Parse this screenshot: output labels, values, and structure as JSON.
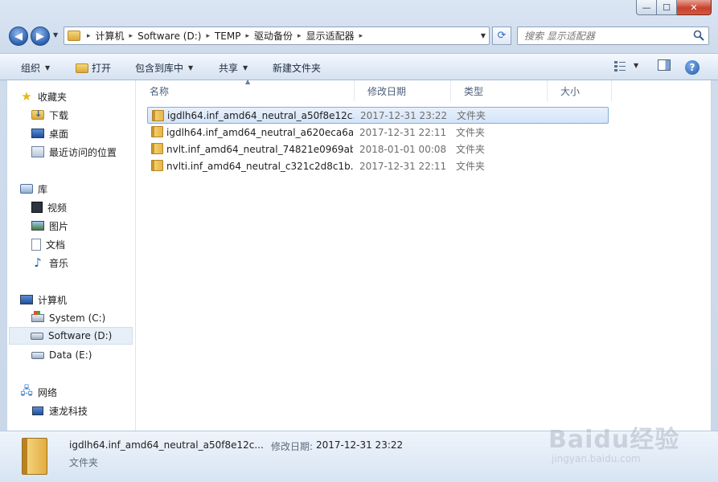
{
  "window": {
    "minimize": "—",
    "maximize": "☐",
    "close": "✕"
  },
  "address": {
    "crumbs": [
      "计算机",
      "Software (D:)",
      "TEMP",
      "驱动备份",
      "显示适配器"
    ],
    "separator": "▸"
  },
  "search": {
    "placeholder": "搜索 显示适配器"
  },
  "toolbar": {
    "organize": "组织",
    "open": "打开",
    "include_in_library": "包含到库中",
    "share": "共享",
    "new_folder": "新建文件夹"
  },
  "nav": {
    "favorites": "收藏夹",
    "downloads": "下载",
    "desktop": "桌面",
    "recent": "最近访问的位置",
    "libraries": "库",
    "videos": "视频",
    "pictures": "图片",
    "documents": "文档",
    "music": "音乐",
    "computer": "计算机",
    "drive_c": "System (C:)",
    "drive_d": "Software (D:)",
    "drive_e": "Data (E:)",
    "network": "网络",
    "network_pc": "速龙科技"
  },
  "columns": {
    "name": "名称",
    "modified": "修改日期",
    "type": "类型",
    "size": "大小"
  },
  "files": [
    {
      "name": "igdlh64.inf_amd64_neutral_a50f8e12c...",
      "modified": "2017-12-31 23:22",
      "type": "文件夹"
    },
    {
      "name": "igdlh64.inf_amd64_neutral_a620eca6a...",
      "modified": "2017-12-31 22:11",
      "type": "文件夹"
    },
    {
      "name": "nvlt.inf_amd64_neutral_74821e0969ab...",
      "modified": "2018-01-01 00:08",
      "type": "文件夹"
    },
    {
      "name": "nvlti.inf_amd64_neutral_c321c2d8c1b...",
      "modified": "2017-12-31 22:11",
      "type": "文件夹"
    }
  ],
  "details": {
    "name": "igdlh64.inf_amd64_neutral_a50f8e12c...",
    "modified_label": "修改日期:",
    "modified": "2017-12-31 23:22",
    "type": "文件夹"
  },
  "watermark": {
    "text": "Baidu经验",
    "sub": "jingyan.baidu.com"
  }
}
